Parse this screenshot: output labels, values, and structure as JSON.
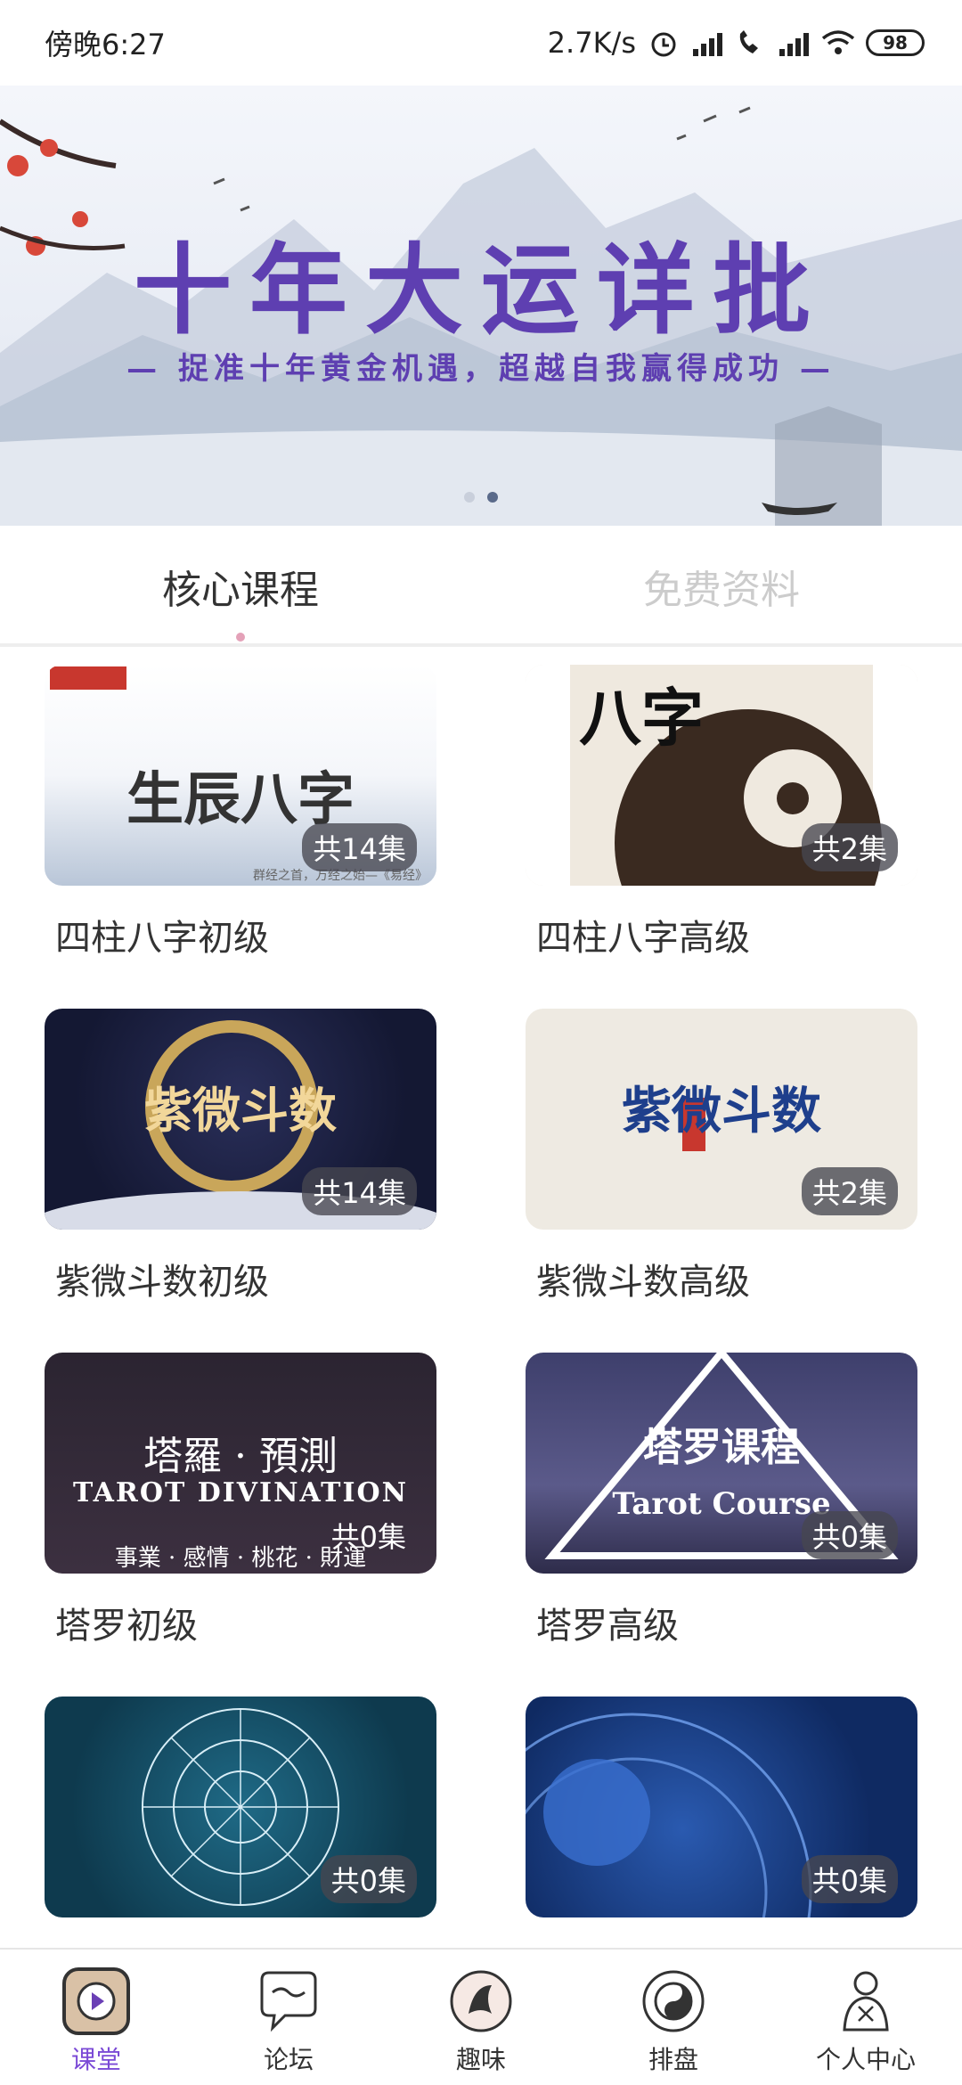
{
  "status_bar": {
    "time": "傍晚6:27",
    "net_speed": "2.7K/s",
    "battery": "98"
  },
  "banner": {
    "title": "十年大运详批",
    "subtitle": "— 捉准十年黄金机遇，超越自我赢得成功 —"
  },
  "tabs": [
    {
      "label": "核心课程",
      "active": true
    },
    {
      "label": "免费资料",
      "active": false
    }
  ],
  "courses": [
    {
      "title": "四柱八字初级",
      "episodes": "共14集",
      "thumb_text": "生辰八字",
      "thumb_caption": "群经之首，万经之始—《易经》"
    },
    {
      "title": "四柱八字高级",
      "episodes": "共2集",
      "thumb_text": "八字"
    },
    {
      "title": "紫微斗数初级",
      "episodes": "共14集",
      "thumb_text": "紫微斗数"
    },
    {
      "title": "紫微斗数高级",
      "episodes": "共2集",
      "thumb_text": "紫微斗数"
    },
    {
      "title": "塔罗初级",
      "episodes": "共0集",
      "thumb_text": "塔羅 · 預測",
      "thumb_caption": "TAROT DIVINATION",
      "thumb_caption2": "事業 · 感情 · 桃花 · 財運"
    },
    {
      "title": "塔罗高级",
      "episodes": "共0集",
      "thumb_text": "塔罗课程",
      "thumb_caption": "Tarot Course"
    },
    {
      "title": "",
      "episodes": "共0集"
    },
    {
      "title": "",
      "episodes": "共0集"
    }
  ],
  "bottom_nav": [
    {
      "label": "课堂",
      "icon": "play-icon",
      "active": true
    },
    {
      "label": "论坛",
      "icon": "chat-icon",
      "active": false
    },
    {
      "label": "趣味",
      "icon": "fish-icon",
      "active": false
    },
    {
      "label": "排盘",
      "icon": "yinyang-icon",
      "active": false
    },
    {
      "label": "个人中心",
      "icon": "person-icon",
      "active": false
    }
  ],
  "colors": {
    "accent": "#7b4ad6",
    "banner_title": "#5e3fb1"
  }
}
